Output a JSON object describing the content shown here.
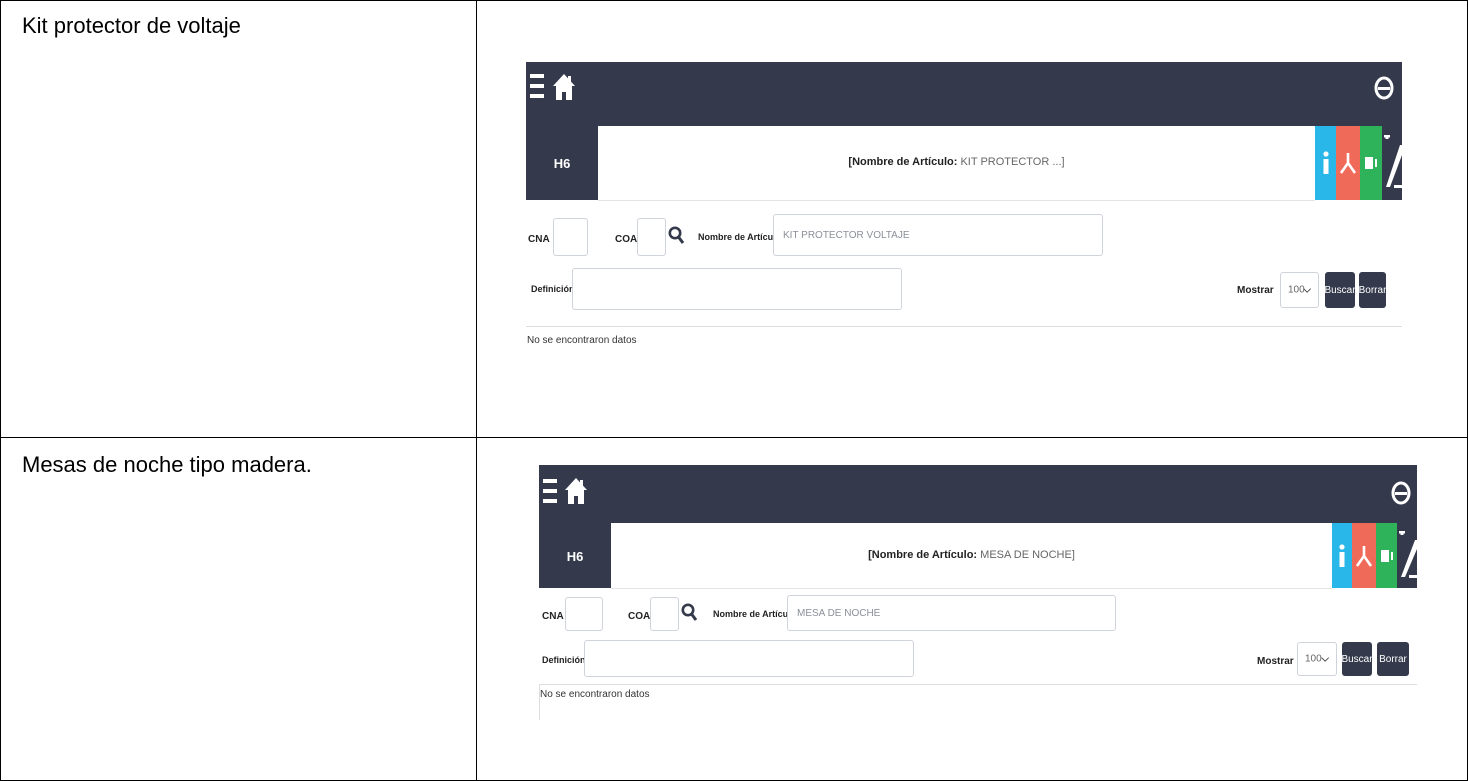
{
  "rows": [
    {
      "label": "Kit protector de voltaje",
      "app": {
        "sidebar_label": "H6",
        "title_key": "[Nombre de Artículo:",
        "title_value": "KIT PROTECTOR ...]",
        "cna_label": "CNA",
        "coa_label": "COA",
        "nombre_label": "Nombre de Artículo",
        "nombre_value": "KIT PROTECTOR VOLTAJE",
        "definicion_label": "Definición",
        "mostrar_label": "Mostrar",
        "mostrar_value": "100",
        "buscar_label": "Buscar",
        "borrar_label": "Borrar",
        "empty_message": "No se encontraron datos"
      }
    },
    {
      "label": "Mesas de noche tipo madera.",
      "app": {
        "sidebar_label": "H6",
        "title_key": "[Nombre de Artículo:",
        "title_value": "MESA DE NOCHE]",
        "cna_label": "CNA",
        "coa_label": "COA",
        "nombre_label": "Nombre de Artículo",
        "nombre_value": "MESA DE NOCHE",
        "definicion_label": "Definición",
        "mostrar_label": "Mostrar",
        "mostrar_value": "100",
        "buscar_label": "Buscar",
        "borrar_label": "Borrar",
        "empty_message": "No se encontraron datos"
      }
    }
  ],
  "icons": {
    "menu": "menu-icon",
    "home": "home-icon",
    "user": "user-icon",
    "info": "info-icon",
    "pdf": "pdf-icon",
    "excel": "excel-icon",
    "toggle": "plus-minus-icon",
    "search": "search-icon"
  },
  "colors": {
    "navbar": "#343a4c",
    "info": "#29b6e8",
    "pdf": "#f06a5a",
    "excel": "#2fb35a",
    "toggle": "#343a4c"
  }
}
